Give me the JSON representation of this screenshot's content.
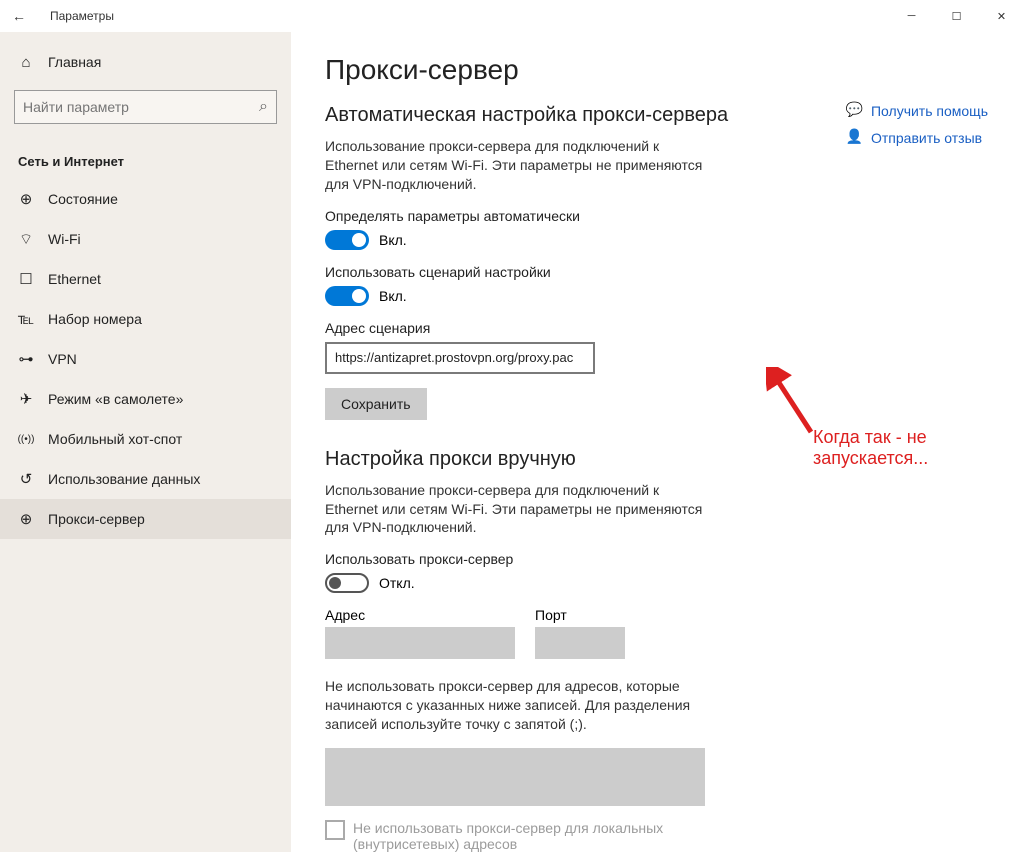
{
  "titlebar": {
    "back": "←",
    "title": "Параметры"
  },
  "sidebar": {
    "home": "Главная",
    "search_placeholder": "Найти параметр",
    "section": "Сеть и Интернет",
    "items": [
      {
        "icon": "⊕",
        "label": "Состояние"
      },
      {
        "icon": "⌔",
        "label": "Wi-Fi"
      },
      {
        "icon": "☐",
        "label": "Ethernet"
      },
      {
        "icon": "℡",
        "label": "Набор номера"
      },
      {
        "icon": "⊶",
        "label": "VPN"
      },
      {
        "icon": "✈",
        "label": "Режим «в самолете»"
      },
      {
        "icon": "((•))",
        "label": "Мобильный хот-спот"
      },
      {
        "icon": "↺",
        "label": "Использование данных"
      },
      {
        "icon": "⊕",
        "label": "Прокси-сервер"
      }
    ]
  },
  "main": {
    "h1": "Прокси-сервер",
    "auto": {
      "h2": "Автоматическая настройка прокси-сервера",
      "desc": "Использование прокси-сервера для подключений к Ethernet или сетям Wi-Fi. Эти параметры не применяются для VPN-подключений.",
      "toggle1_label": "Определять параметры автоматически",
      "toggle1_state": "Вкл.",
      "toggle2_label": "Использовать сценарий настройки",
      "toggle2_state": "Вкл.",
      "script_label": "Адрес сценария",
      "script_value": "https://antizapret.prostovpn.org/proxy.pac",
      "save": "Сохранить"
    },
    "manual": {
      "h2": "Настройка прокси вручную",
      "desc": "Использование прокси-сервера для подключений к Ethernet или сетям Wi-Fi. Эти параметры не применяются для VPN-подключений.",
      "toggle_label": "Использовать прокси-сервер",
      "toggle_state": "Откл.",
      "addr_label": "Адрес",
      "port_label": "Порт",
      "bypass_desc": "Не использовать прокси-сервер для адресов, которые начинаются с указанных ниже записей. Для разделения записей используйте точку с запятой (;).",
      "local_check": "Не использовать прокси-сервер для локальных (внутрисетевых) адресов"
    }
  },
  "rightlinks": {
    "help": "Получить помощь",
    "feedback": "Отправить отзыв"
  },
  "annotation": "Когда так - не запускается..."
}
